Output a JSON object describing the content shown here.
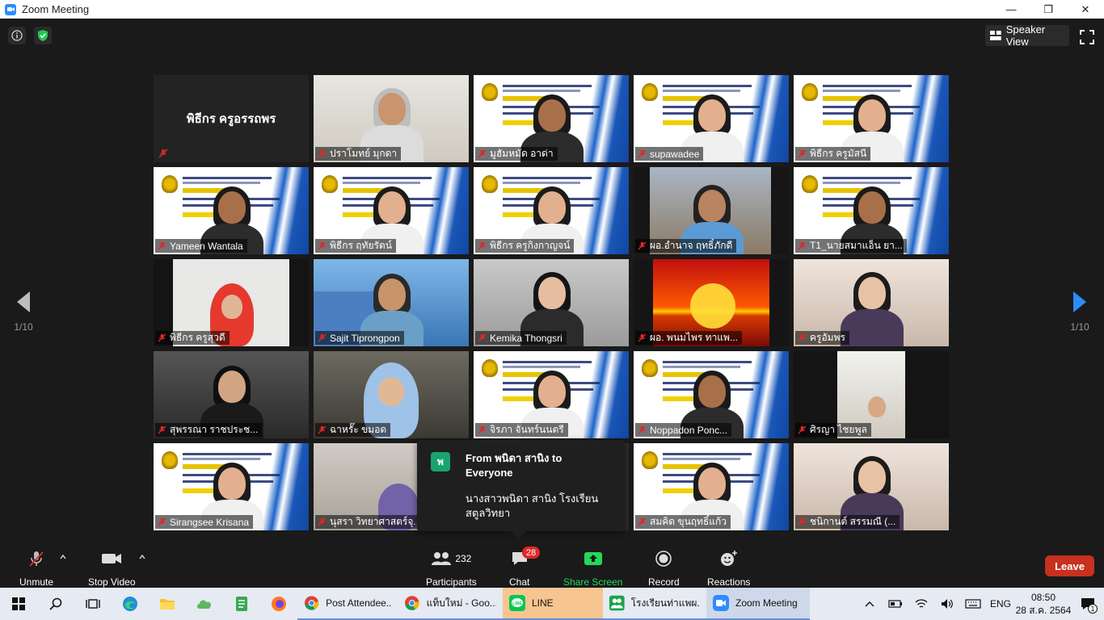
{
  "window": {
    "title": "Zoom Meeting",
    "controls": [
      "—",
      "❐",
      "✕"
    ]
  },
  "view": {
    "speaker_view_label": "Speaker View"
  },
  "pagination": {
    "left_page": "1/10",
    "right_page": "1/10"
  },
  "tiles": [
    {
      "name": "พิธีกร ครูอรรถพร",
      "kind": "name-only"
    },
    {
      "name": "ปราโมทย์  มุกดา",
      "kind": "video-man-room"
    },
    {
      "name": "มูฮัมหมัด อาด่า",
      "kind": "slide-man"
    },
    {
      "name": "supawadee",
      "kind": "slide-woman"
    },
    {
      "name": "พิธีกร ครูมัสนี",
      "kind": "slide-woman"
    },
    {
      "name": "Yameen Wantala",
      "kind": "slide-man"
    },
    {
      "name": "พิธีกร ฤทัยรัตน์",
      "kind": "slide-woman",
      "active": true
    },
    {
      "name": "พิธีกร ครูกิงกาญจน์",
      "kind": "slide-woman"
    },
    {
      "name": "ผอ.อำนาจ ฤทธิ์ภักดี",
      "kind": "video-man-office"
    },
    {
      "name": "T1_นายสมาแอ็น ยา...",
      "kind": "slide-man"
    },
    {
      "name": "พิธีกร ครูสุวดี",
      "kind": "video-woman-hijab-red"
    },
    {
      "name": "Sajit Tiprongpon",
      "kind": "video-woman-school"
    },
    {
      "name": "Kemika Thongsri",
      "kind": "video-woman-plain"
    },
    {
      "name": "ผอ. พนมไพร ทาแพ...",
      "kind": "video-sunset"
    },
    {
      "name": "ครูอัมพร",
      "kind": "video-woman-room"
    },
    {
      "name": "สุพรรณา  ราชประช...",
      "kind": "video-woman-dark"
    },
    {
      "name": "ฉาหรั๊ะ  ขมอด",
      "kind": "video-woman-hijab-blue"
    },
    {
      "name": "จิรภา จันทร์นนตรี",
      "kind": "slide-woman"
    },
    {
      "name": "Noppadon Ponc...",
      "kind": "slide-man"
    },
    {
      "name": "ศิรญา  ไชยพูล",
      "kind": "video-small"
    },
    {
      "name": "Sirangsee Krisana",
      "kind": "slide-woman"
    },
    {
      "name": "นุสรา วิทยาศาสตร์จุ...",
      "kind": "video-woman-hijab-purple"
    },
    {
      "name": "",
      "kind": "video-hidden"
    },
    {
      "name": "สมคิด ขุนฤทธิ์แก้ว",
      "kind": "slide-woman"
    },
    {
      "name": "ชนิกานต์  สรรมณี (...",
      "kind": "video-woman-room"
    }
  ],
  "chat_popup": {
    "avatar_letter": "พ",
    "from": "From พนิดา สานิง to Everyone",
    "message": "นางสาวพนิดา  สานิง โรงเรียนสตูลวิทยา"
  },
  "toolbar": {
    "unmute": "Unmute",
    "stop_video": "Stop Video",
    "participants": "Participants",
    "participants_count": "232",
    "chat": "Chat",
    "chat_badge": "28",
    "share_screen": "Share Screen",
    "record": "Record",
    "reactions": "Reactions",
    "leave": "Leave"
  },
  "taskbar": {
    "apps": [
      {
        "label": "Post Attendee..."
      },
      {
        "label": "แท็บใหม่ - Goo..."
      },
      {
        "label": "LINE"
      },
      {
        "label": "โรงเรียนท่าแพผ..."
      },
      {
        "label": "Zoom Meeting"
      }
    ],
    "language": "ENG",
    "time": "08:50",
    "date": "28 ส.ค. 2564",
    "notification_count": "1"
  },
  "colors": {
    "accent_green": "#23d959",
    "leave_red": "#c8301f",
    "active_outline": "#d4e157",
    "badge_red": "#e02828"
  }
}
